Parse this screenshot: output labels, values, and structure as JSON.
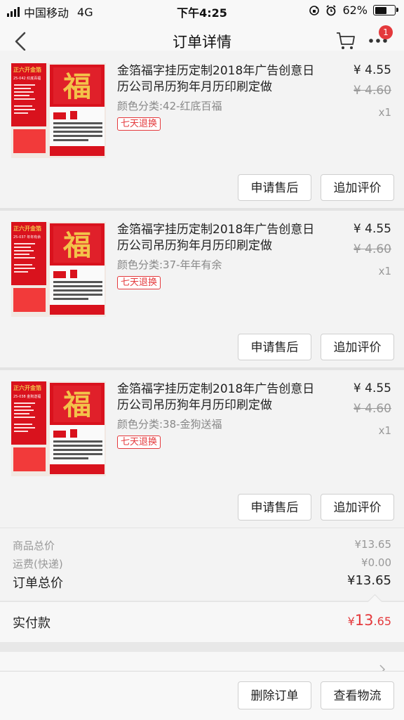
{
  "status_bar": {
    "carrier": "中国移动",
    "network": "4G",
    "time": "下午4:25",
    "battery_text": "62%",
    "battery_level": 0.62
  },
  "nav": {
    "title": "订单详情",
    "more_badge": "1"
  },
  "products": [
    {
      "title": "金箔福字挂历定制2018年广告创意日历公司吊历狗年月历印刷定做",
      "spec": "颜色分类:42-红底百福",
      "tag": "七天退换",
      "price": "¥ 4.55",
      "orig_price": "¥ 4.60",
      "qty": "x1",
      "btn_after_sale": "申请售后",
      "btn_review": "追加评价",
      "thumb_caption": "正六开金箔",
      "thumb_model": "25-042 红底百福"
    },
    {
      "title": "金箔福字挂历定制2018年广告创意日历公司吊历狗年月历印刷定做",
      "spec": "颜色分类:37-年年有余",
      "tag": "七天退换",
      "price": "¥ 4.55",
      "orig_price": "¥ 4.60",
      "qty": "x1",
      "btn_after_sale": "申请售后",
      "btn_review": "追加评价",
      "thumb_caption": "正六开金箔",
      "thumb_model": "25-037 年年有余"
    },
    {
      "title": "金箔福字挂历定制2018年广告创意日历公司吊历狗年月历印刷定做",
      "spec": "颜色分类:38-金狗送福",
      "tag": "七天退换",
      "price": "¥ 4.55",
      "orig_price": "¥ 4.60",
      "qty": "x1",
      "btn_after_sale": "申请售后",
      "btn_review": "追加评价",
      "thumb_caption": "正六开金箔",
      "thumb_model": "25-038 金狗送福"
    }
  ],
  "summary": {
    "goods_label": "商品总价",
    "goods_value": "¥13.65",
    "shipping_label": "运费(快递)",
    "shipping_value": "¥0.00",
    "order_total_label": "订单总价",
    "order_total_value": "¥13.65",
    "paid_label": "实付款",
    "paid_currency": "¥",
    "paid_int": "13",
    "paid_dec": ".65"
  },
  "footer": {
    "delete_label": "删除订单",
    "logistics_label": "查看物流"
  },
  "colors": {
    "accent": "#e4393c",
    "calendar_red": "#d9121d",
    "gold": "#f3c24a"
  },
  "thumb_fu": "福"
}
